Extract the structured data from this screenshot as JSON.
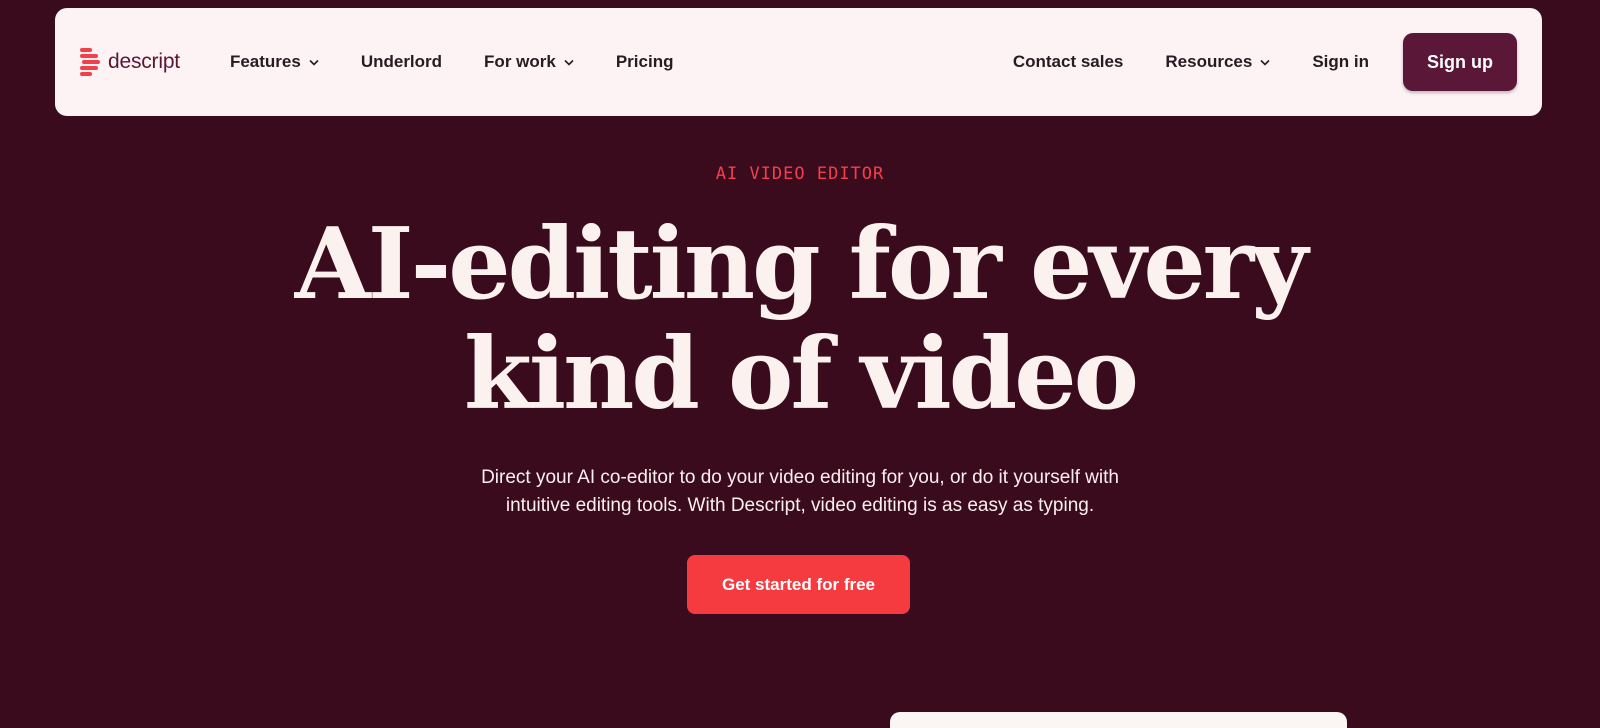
{
  "brand": {
    "name": "descript",
    "logo_color": "#f2404b",
    "wordmark_color": "#5a1733"
  },
  "nav": {
    "left_items": [
      {
        "label": "Features",
        "has_dropdown": true
      },
      {
        "label": "Underlord",
        "has_dropdown": false
      },
      {
        "label": "For work",
        "has_dropdown": true
      },
      {
        "label": "Pricing",
        "has_dropdown": false
      }
    ],
    "right_items": [
      {
        "label": "Contact sales",
        "has_dropdown": false
      },
      {
        "label": "Resources",
        "has_dropdown": true
      },
      {
        "label": "Sign in",
        "has_dropdown": false
      }
    ],
    "signup_label": "Sign up"
  },
  "hero": {
    "eyebrow": "AI VIDEO EDITOR",
    "headline_line1": "AI-editing for every",
    "headline_line2": "kind of video",
    "subtext_line1": "Direct your AI co-editor to do your video editing for you, or do it yourself with",
    "subtext_line2": "intuitive editing tools. With Descript, video editing is as easy as typing.",
    "cta_label": "Get started for free"
  },
  "colors": {
    "background": "#3a0b1c",
    "navbar_bg": "#fdf3f5",
    "accent_red": "#f53b40",
    "signup_bg": "#5b1737",
    "headline": "#fbf1ee"
  }
}
